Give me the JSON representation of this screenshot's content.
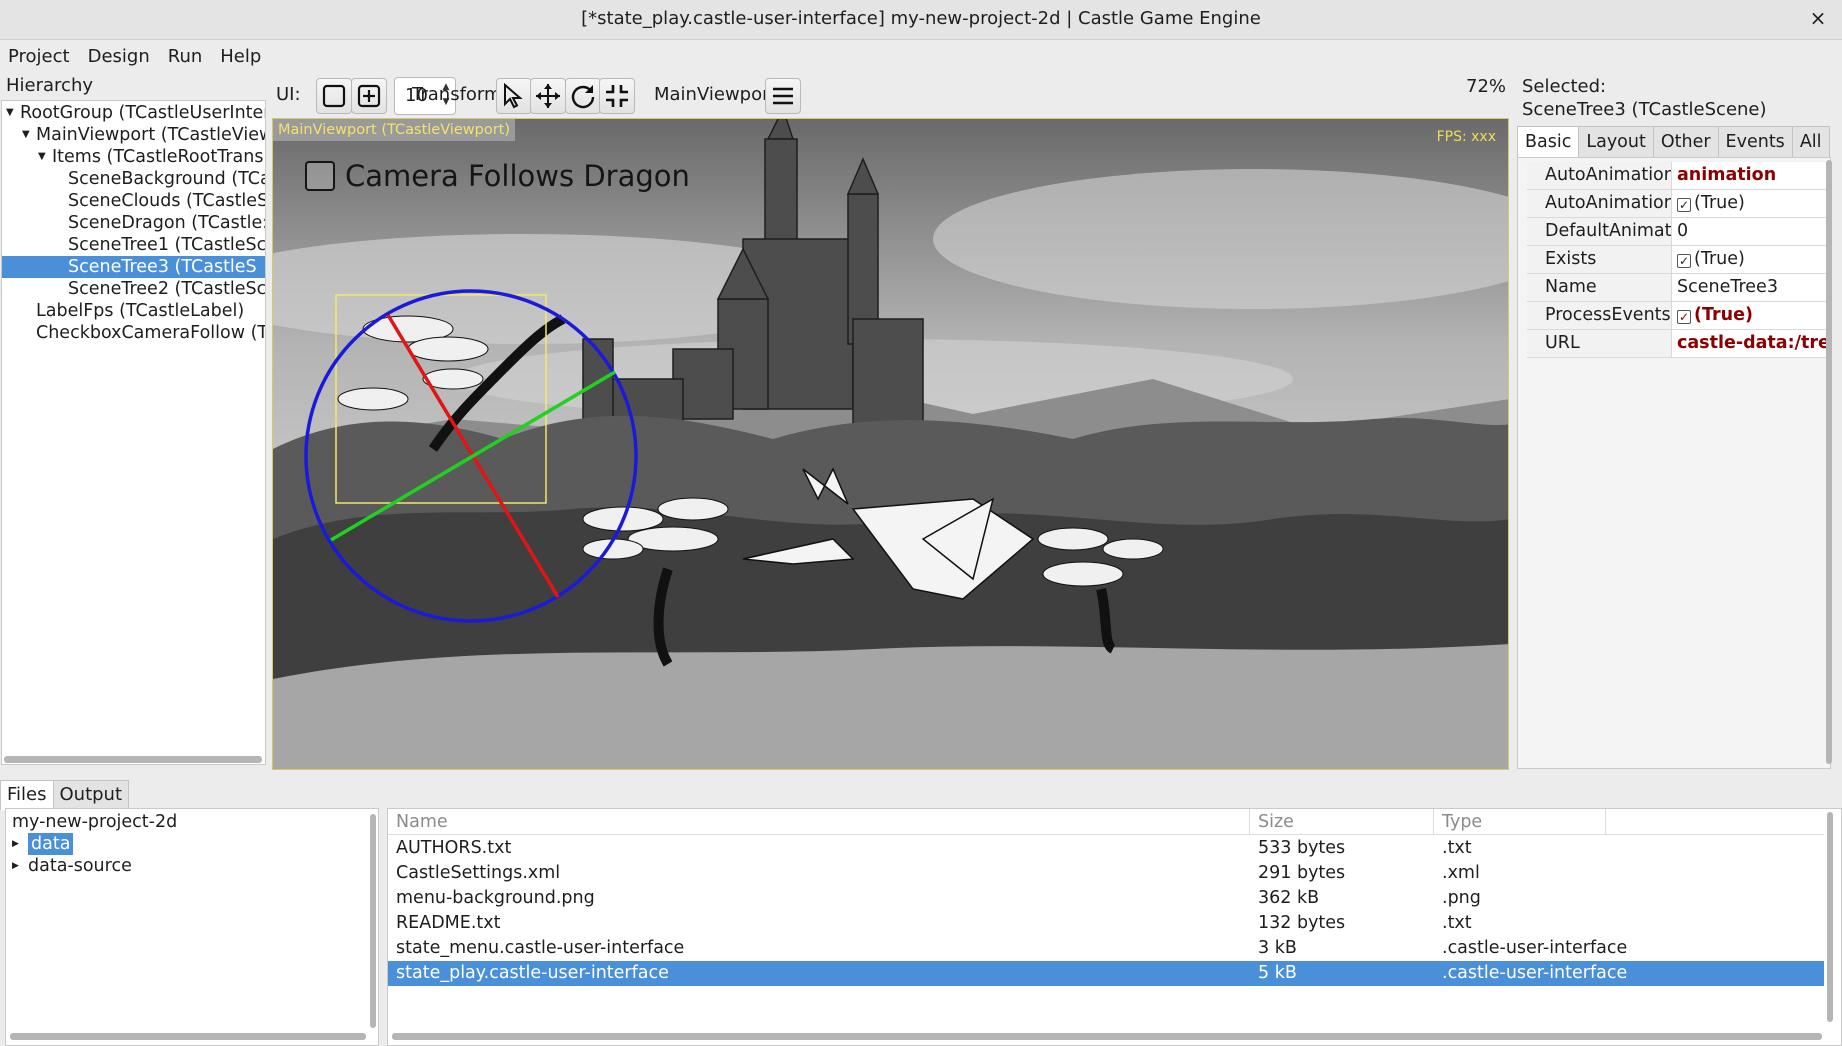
{
  "window": {
    "title": "[*state_play.castle-user-interface] my-new-project-2d | Castle Game Engine",
    "close_glyph": "×"
  },
  "menu": [
    "Project",
    "Design",
    "Run",
    "Help"
  ],
  "hierarchy": {
    "label": "Hierarchy",
    "items": [
      {
        "text": "RootGroup (TCastleUserInter",
        "expander": "expanded",
        "selected": false
      },
      {
        "text": "MainViewport (TCastleView",
        "expander": "expanded",
        "selected": false
      },
      {
        "text": "Items (TCastleRootTrans",
        "expander": "expanded",
        "selected": false
      },
      {
        "text": "SceneBackground (TCa",
        "expander": "none",
        "selected": false
      },
      {
        "text": "SceneClouds (TCastleS",
        "expander": "none",
        "selected": false
      },
      {
        "text": "SceneDragon (TCastle:",
        "expander": "none",
        "selected": false
      },
      {
        "text": "SceneTree1 (TCastleSc",
        "expander": "none",
        "selected": false
      },
      {
        "text": "SceneTree3 (TCastleS",
        "expander": "none",
        "selected": true
      },
      {
        "text": "SceneTree2 (TCastleSc",
        "expander": "none",
        "selected": false
      },
      {
        "text": "LabelFps (TCastleLabel)",
        "expander": "none",
        "selected": false
      },
      {
        "text": "CheckboxCameraFollow (TC",
        "expander": "none",
        "selected": false
      }
    ]
  },
  "toolbar": {
    "ui_label": "UI:",
    "spin_value": "10",
    "transform_label": "Transform:",
    "viewport_label": "MainViewport:",
    "zoom": "72%",
    "icons": [
      "select-rect-icon",
      "add-component-icon",
      "select-arrow-icon",
      "move-icon",
      "rotate-icon",
      "scale-icon",
      "hamburger-menu-icon"
    ]
  },
  "viewport": {
    "badge": "MainViewport (TCastleViewport)",
    "fps": "FPS: xxx",
    "checkbox_label": "Camera Follows Dragon"
  },
  "inspector": {
    "selected_label": "Selected:",
    "selected_name": "SceneTree3 (TCastleScene)",
    "tabs": [
      "Basic",
      "Layout",
      "Other",
      "Events",
      "All"
    ],
    "active_tab": "Basic",
    "properties": [
      {
        "name": "AutoAnimation",
        "value": "animation",
        "bold": true,
        "checkbox": false
      },
      {
        "name": "AutoAnimation",
        "value": "(True)",
        "bold": false,
        "checkbox": true
      },
      {
        "name": "DefaultAnimati",
        "value": "0",
        "bold": false,
        "checkbox": false
      },
      {
        "name": "Exists",
        "value": "(True)",
        "bold": false,
        "checkbox": true
      },
      {
        "name": "Name",
        "value": "SceneTree3",
        "bold": false,
        "checkbox": false
      },
      {
        "name": "ProcessEvents",
        "value": "(True)",
        "bold": true,
        "checkbox": true
      },
      {
        "name": "URL",
        "value": "castle-data:/trees",
        "bold": true,
        "checkbox": false
      }
    ]
  },
  "bottom": {
    "tabs": [
      "Files",
      "Output"
    ],
    "active_tab": "Files",
    "tree": [
      {
        "text": "my-new-project-2d",
        "expander": "none",
        "selected": false,
        "indent": 0
      },
      {
        "text": "data",
        "expander": "collapsed",
        "selected": true,
        "indent": 1
      },
      {
        "text": "data-source",
        "expander": "collapsed",
        "selected": false,
        "indent": 1
      }
    ],
    "columns": [
      "Name",
      "Size",
      "Type"
    ],
    "files": [
      {
        "name": "AUTHORS.txt",
        "size": "533 bytes",
        "type": ".txt",
        "selected": false
      },
      {
        "name": "CastleSettings.xml",
        "size": "291 bytes",
        "type": ".xml",
        "selected": false
      },
      {
        "name": "menu-background.png",
        "size": "362 kB",
        "type": ".png",
        "selected": false
      },
      {
        "name": "README.txt",
        "size": "132 bytes",
        "type": ".txt",
        "selected": false
      },
      {
        "name": "state_menu.castle-user-interface",
        "size": "3 kB",
        "type": ".castle-user-interface",
        "selected": false
      },
      {
        "name": "state_play.castle-user-interface",
        "size": "5 kB",
        "type": ".castle-user-interface",
        "selected": true
      }
    ]
  }
}
